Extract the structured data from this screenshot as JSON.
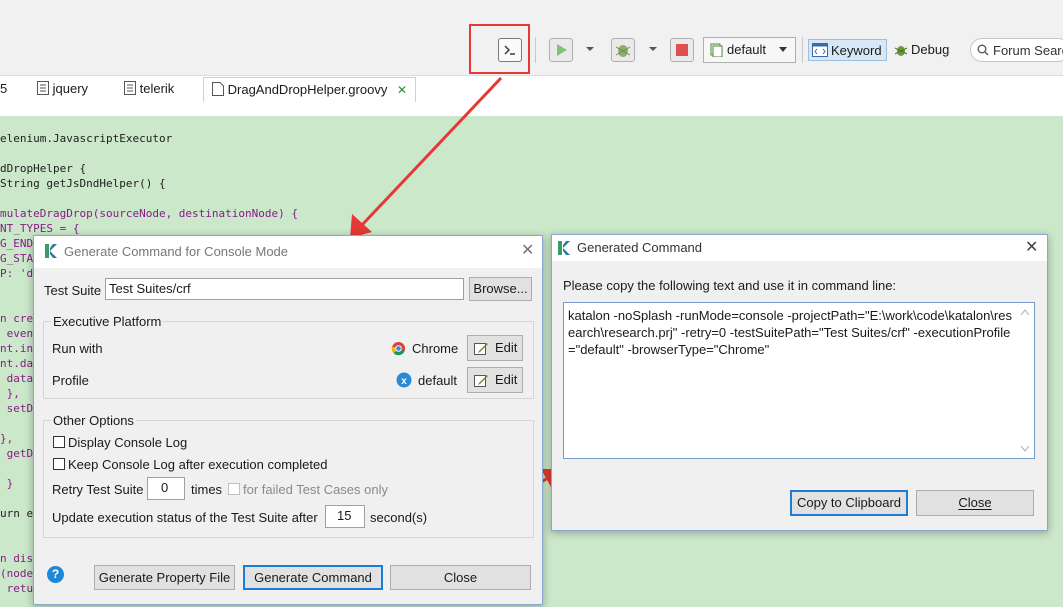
{
  "toolbar": {
    "profile_select": "default",
    "keyword_label": "Keyword",
    "debug_label": "Debug",
    "search_placeholder": "Forum Searc"
  },
  "tabs": [
    {
      "label": "5"
    },
    {
      "label": "jquery"
    },
    {
      "label": "telerik"
    },
    {
      "label": "DragAndDropHelper.groovy"
    }
  ],
  "code_lines": [
    "elenium.JavascriptExecutor",
    "",
    "dDropHelper {",
    "String getJsDndHelper() {",
    "",
    "mulateDragDrop(sourceNode, destinationNode) {",
    "NT_TYPES = {",
    "G_END",
    "G_STA",
    "P: 'd",
    "",
    "",
    "n cre",
    " event",
    "nt.in",
    "nt.da",
    " data",
    " },",
    " setD",
    "",
    "},",
    " getD",
    "",
    " }",
    "",
    "urn e",
    "",
    "",
    "n disp",
    "(node",
    " retu"
  ],
  "generate_dialog": {
    "title": "Generate Command for Console Mode",
    "test_suite_label": "Test Suite",
    "test_suite_value": "Test Suites/crf",
    "browse_button": "Browse...",
    "executive_platform_label": "Executive Platform",
    "run_with_label": "Run with",
    "run_with_value": "Chrome",
    "profile_label": "Profile",
    "profile_value": "default",
    "edit_label": "Edit",
    "other_options_label": "Other Options",
    "display_console_log": "Display Console Log",
    "keep_console_log": "Keep Console Log after execution completed",
    "retry_label": "Retry Test Suite",
    "retry_value": "0",
    "times_label": "times",
    "failed_only_label": "for failed Test Cases only",
    "update_status_label": "Update execution status of the Test Suite after",
    "update_status_value": "15",
    "seconds_label": "second(s)",
    "help_icon_glyph": "?",
    "generate_property_button": "Generate Property File",
    "generate_command_button": "Generate Command",
    "close_button": "Close"
  },
  "generated_dialog": {
    "title": "Generated Command",
    "instruction": "Please copy the following text and use it in command line:",
    "command_text": "katalon -noSplash  -runMode=console -projectPath=\"E:\\work\\code\\katalon\\research\\research.prj\" -retry=0 -testSuitePath=\"Test Suites/crf\" -executionProfile=\"default\" -browserType=\"Chrome\"",
    "copy_button": "Copy to Clipboard",
    "close_button": "Close"
  },
  "colors": {
    "editor_bg": "#cbe8cb",
    "keyword": "#8a1a8a",
    "highlight_red": "#e53935",
    "accent_blue": "#1e7bd6"
  }
}
